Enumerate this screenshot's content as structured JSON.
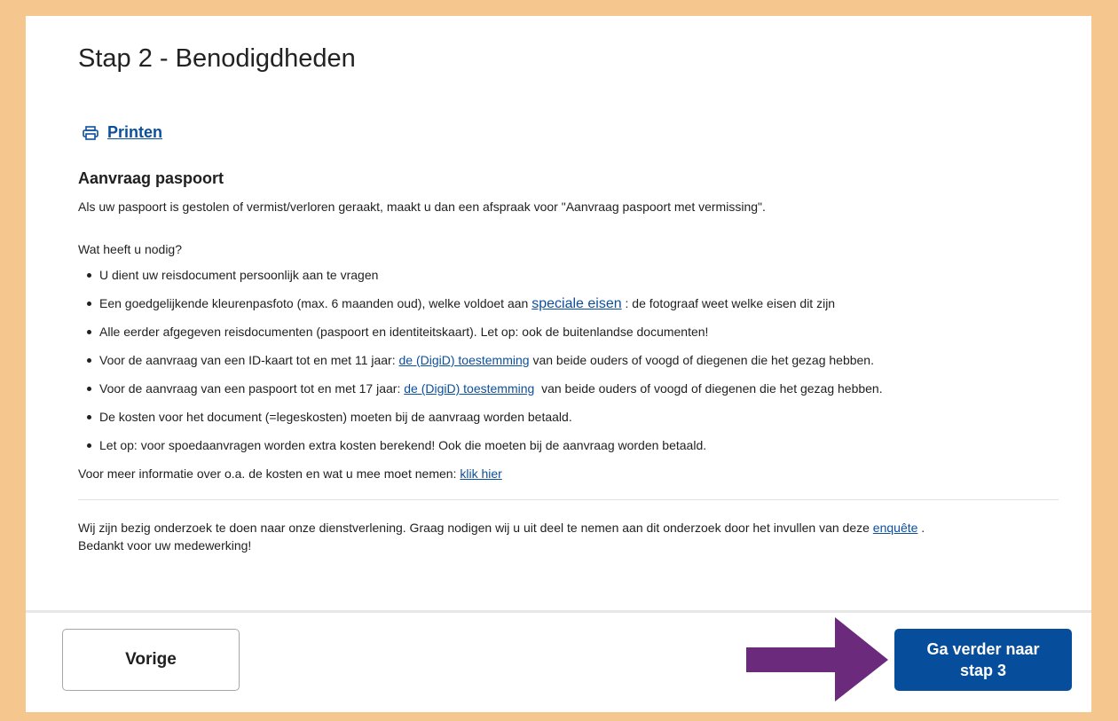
{
  "page": {
    "title": "Stap 2 - Benodigdheden",
    "print_label": "Printen",
    "print_icon": "printer-icon"
  },
  "content": {
    "section_title": "Aanvraag paspoort",
    "intro": "Als uw paspoort is gestolen of vermist/verloren geraakt, maakt u dan een afspraak voor \"Aanvraag paspoort met vermissing\".",
    "question": "Wat heeft u nodig?",
    "requirements": [
      {
        "text": "U dient uw reisdocument persoonlijk aan te vragen"
      },
      {
        "before": "Een goedgelijkende kleurenpasfoto (max. 6 maanden oud), welke voldoet aan ",
        "link": "speciale eisen",
        "after": " : de fotograaf weet welke eisen dit zijn"
      },
      {
        "text": "Alle eerder afgegeven reisdocumenten (paspoort en identiteitskaart). Let op: ook de buitenlandse documenten!"
      },
      {
        "before": "Voor de aanvraag van een ID-kaart tot en met 11 jaar: ",
        "link": "de (DigiD) toestemming",
        "after": " van beide ouders of voogd of diegenen die het gezag hebben."
      },
      {
        "before": "Voor de aanvraag van een paspoort tot en met 17 jaar: ",
        "link": "de (DigiD) toestemming",
        "after": "  van beide ouders of voogd of diegenen die het gezag hebben."
      },
      {
        "text": "De kosten voor het document (=legeskosten) moeten bij de aanvraag worden betaald."
      },
      {
        "text": "Let op: voor spoedaanvragen worden extra kosten berekend! Ook die moeten bij de aanvraag worden betaald."
      }
    ],
    "more_info_text": "Voor meer informatie over o.a. de kosten en wat u mee moet nemen: ",
    "more_info_link": "klik hier",
    "survey_text": "Wij zijn bezig onderzoek te doen naar onze dienstverlening. Graag nodigen wij u uit deel te nemen aan dit onderzoek door het invullen van deze ",
    "survey_link": "enquête",
    "survey_after": " .",
    "thanks": "Bedankt voor uw medewerking!"
  },
  "footer": {
    "prev_label": "Vorige",
    "next_line1": "Ga verder naar",
    "next_line2": "stap 3",
    "arrow_color": "#6b2a7b",
    "next_color": "#064d9b"
  },
  "colors": {
    "frame": "#f5c78e",
    "link": "#0b4f9c"
  }
}
